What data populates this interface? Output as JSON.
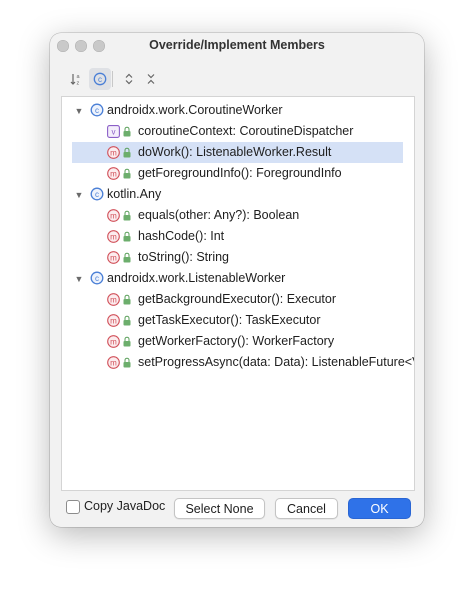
{
  "window": {
    "title": "Override/Implement Members"
  },
  "toolbar": {
    "sort_icon": "sort-alphabetically-icon",
    "inherited_icon": "show-classes-icon",
    "expand_icon": "expand-all-icon",
    "collapse_icon": "collapse-all-icon"
  },
  "tree": {
    "groups": [
      {
        "label": "androidx.work.CoroutineWorker",
        "members": [
          {
            "label": "coroutineContext: CoroutineDispatcher",
            "kind": "property"
          },
          {
            "label": "doWork(): ListenableWorker.Result",
            "kind": "method",
            "selected": true
          },
          {
            "label": "getForegroundInfo(): ForegroundInfo",
            "kind": "method"
          }
        ]
      },
      {
        "label": "kotlin.Any",
        "members": [
          {
            "label": "equals(other: Any?): Boolean",
            "kind": "method"
          },
          {
            "label": "hashCode(): Int",
            "kind": "method"
          },
          {
            "label": "toString(): String",
            "kind": "method"
          }
        ]
      },
      {
        "label": "androidx.work.ListenableWorker",
        "members": [
          {
            "label": "getBackgroundExecutor(): Executor",
            "kind": "method"
          },
          {
            "label": "getTaskExecutor(): TaskExecutor",
            "kind": "method"
          },
          {
            "label": "getWorkerFactory(): WorkerFactory",
            "kind": "method"
          },
          {
            "label": "setProgressAsync(data: Data): ListenableFuture<Vo",
            "kind": "method"
          }
        ]
      }
    ]
  },
  "footer": {
    "copy_javadoc_label": "Copy JavaDoc",
    "copy_javadoc_checked": false,
    "select_none_label": "Select None",
    "cancel_label": "Cancel",
    "ok_label": "OK"
  },
  "colors": {
    "accent": "#2f72e8",
    "selection": "#d5e1f6",
    "method_icon": "#d1525b",
    "property_icon": "#8b5fc7",
    "class_icon": "#4a7fd6",
    "lock_icon": "#5aa05a"
  }
}
